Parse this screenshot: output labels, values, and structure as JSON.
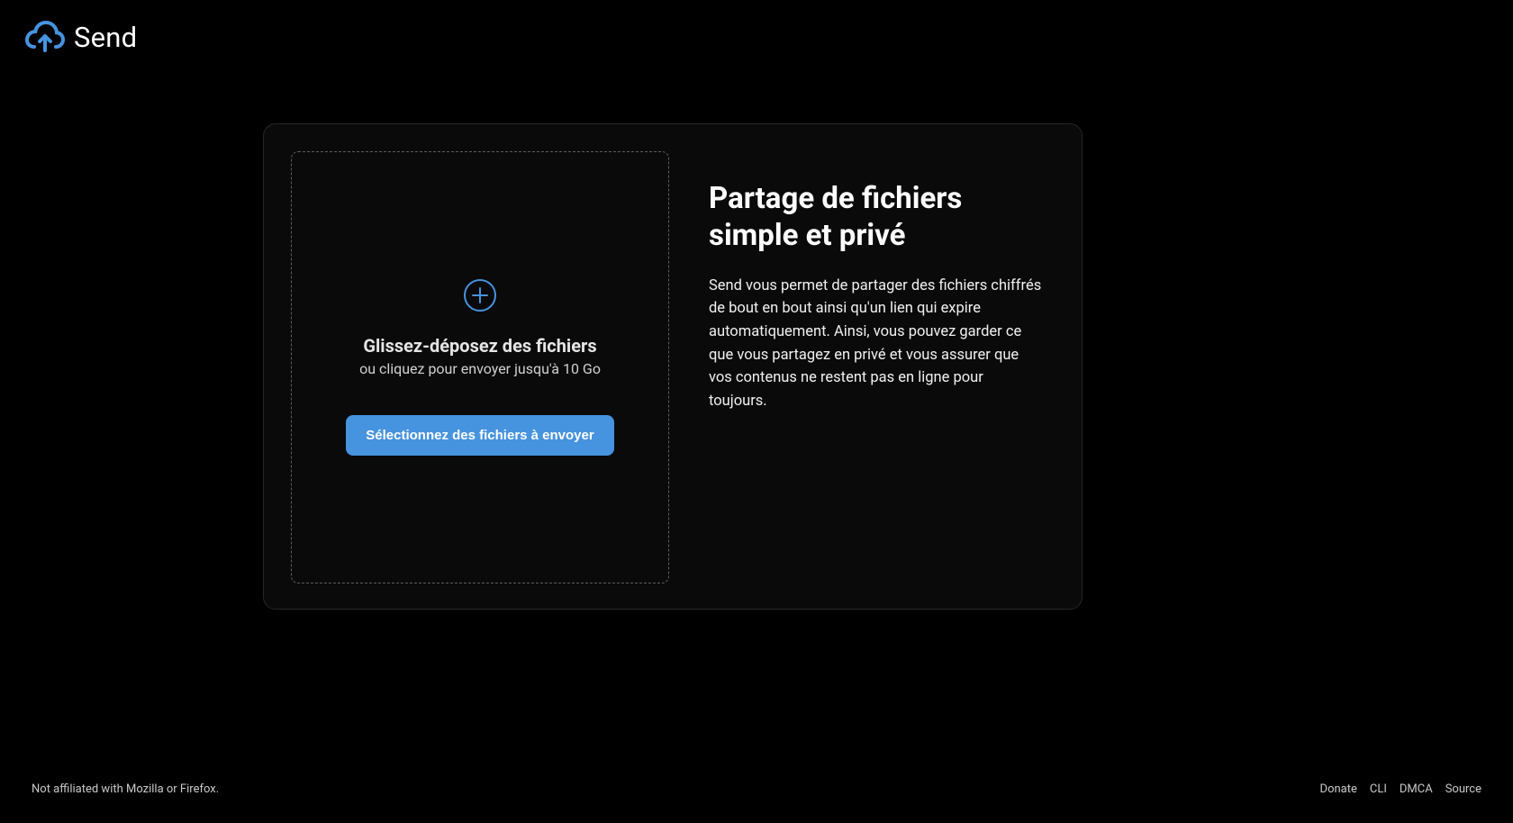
{
  "header": {
    "logo_text": "Send"
  },
  "dropzone": {
    "title": "Glissez-déposez des fichiers",
    "subtitle": "ou cliquez pour envoyer jusqu'à 10 Go",
    "button_label": "Sélectionnez des fichiers à envoyer"
  },
  "info": {
    "title": "Partage de fichiers simple et privé",
    "description": "Send vous permet de partager des fichiers chiffrés de bout en bout ainsi qu'un lien qui expire automatiquement. Ainsi, vous pouvez garder ce que vous partagez en privé et vous assurer que vos contenus ne restent pas en ligne pour toujours."
  },
  "footer": {
    "disclaimer": "Not affiliated with Mozilla or Firefox.",
    "links": {
      "donate": "Donate",
      "cli": "CLI",
      "dmca": "DMCA",
      "source": "Source"
    }
  },
  "colors": {
    "accent": "#4693e0"
  }
}
